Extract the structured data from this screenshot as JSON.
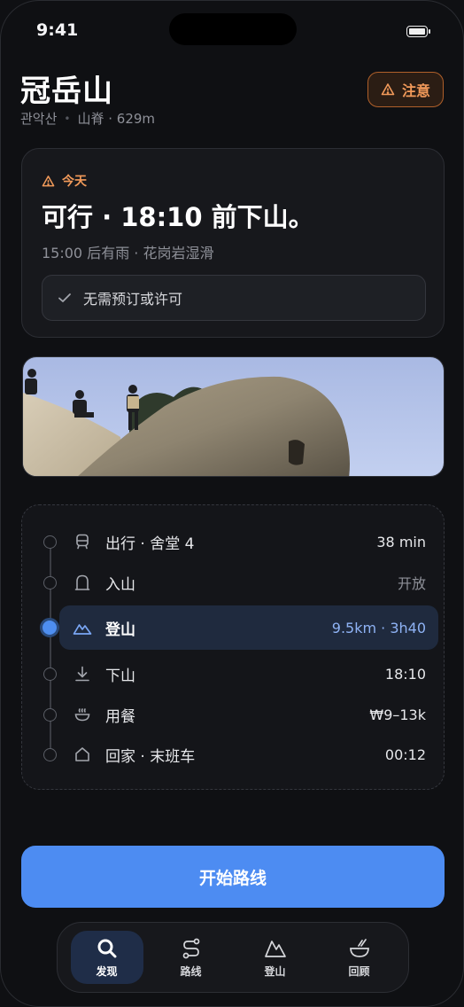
{
  "status_bar": {
    "time": "9:41"
  },
  "header": {
    "title": "冠岳山",
    "subtitle_korean": "관악산",
    "subtitle_detail": "山脊 · 629m",
    "alert_label": "注意"
  },
  "status_card": {
    "tag": "今天",
    "headline": "可行 · 18:10 前下山。",
    "detail": "15:00 后有雨 · 花岗岩湿滑",
    "permit": "无需预订或许可"
  },
  "timeline": [
    {
      "icon": "bus-icon",
      "label": "出行 · 舍堂 4",
      "value": "38 min",
      "active": false,
      "muted": false
    },
    {
      "icon": "gate-icon",
      "label": "入山",
      "value": "开放",
      "active": false,
      "muted": true
    },
    {
      "icon": "mountain-icon",
      "label": "登山",
      "value": "9.5km · 3h40",
      "active": true,
      "muted": false
    },
    {
      "icon": "download-icon",
      "label": "下山",
      "value": "18:10",
      "active": false,
      "muted": false
    },
    {
      "icon": "bowl-icon",
      "label": "用餐",
      "value": "₩9–13k",
      "active": false,
      "muted": false
    },
    {
      "icon": "home-icon",
      "label": "回家 · 末班车",
      "value": "00:12",
      "active": false,
      "muted": false
    }
  ],
  "cta_label": "开始路线",
  "tabs": [
    {
      "label": "发现",
      "icon": "search-icon",
      "active": true
    },
    {
      "label": "路线",
      "icon": "route-icon",
      "active": false
    },
    {
      "label": "登山",
      "icon": "mountain-icon",
      "active": false
    },
    {
      "label": "回顾",
      "icon": "bowl-icon",
      "active": false
    }
  ],
  "colors": {
    "accent_blue": "#4d8cf2",
    "warning_orange": "#f29a5a",
    "background": "#0f1013"
  }
}
